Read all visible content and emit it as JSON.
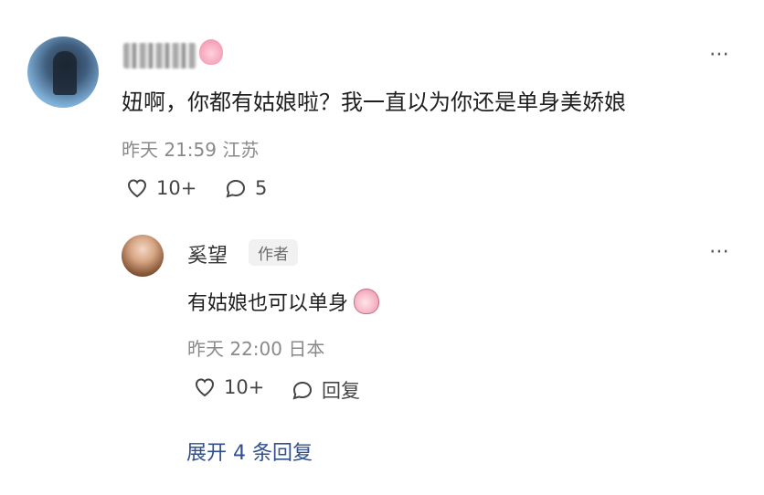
{
  "comment": {
    "username": "",
    "text": "妞啊，你都有姑娘啦？我一直以为你还是单身美娇娘",
    "time": "昨天 21:59",
    "location": "江苏",
    "likes": "10+",
    "replies": "5",
    "more": "⋯"
  },
  "reply": {
    "username": "奚望",
    "tag": "作者",
    "text": "有姑娘也可以单身",
    "time": "昨天 22:00",
    "location": "日本",
    "likes": "10+",
    "reply_label": "回复",
    "more": "⋯"
  },
  "expand": {
    "label": "展开 4 条回复"
  },
  "icons": {
    "like": "heart-outline-icon",
    "comment": "speech-bubble-outline-icon",
    "more": "more-dots-icon"
  },
  "colors": {
    "link": "#2f4f8f",
    "meta": "#8a8a8a"
  }
}
